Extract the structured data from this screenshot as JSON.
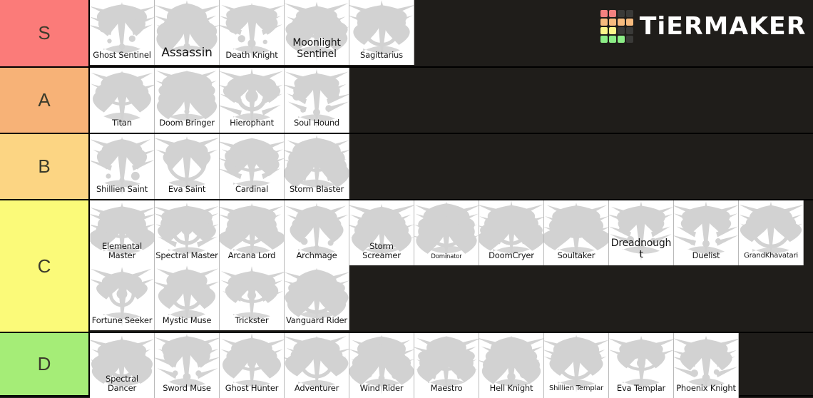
{
  "logo": {
    "wordmark": "TiERMAKER",
    "grid_colors": [
      "#f4817f",
      "#f4817f",
      "#3a3a38",
      "#3a3a38",
      "#f7bb7e",
      "#f7bb7e",
      "#f7bb7e",
      "#f7bb7e",
      "#fbf68a",
      "#fbf68a",
      "#3a3a38",
      "#3a3a38",
      "#8ced87",
      "#8ced87",
      "#8ced87",
      "#3a3a38"
    ]
  },
  "background_color": "#1f1d1a",
  "tiers": [
    {
      "label": "S",
      "color": "#fb7b79",
      "height": 95,
      "items": [
        {
          "name": "Ghost Sentinel",
          "emblem": "ghost-sentinel-emblem",
          "size": "md"
        },
        {
          "name": "Assassin",
          "emblem": "assassin-emblem",
          "size": "xl"
        },
        {
          "name": "Death Knight",
          "emblem": "death-knight-emblem",
          "size": "md"
        },
        {
          "name": "Moonlight Sentinel",
          "emblem": "moonlight-sentinel-emblem",
          "size": "lg"
        },
        {
          "name": "Sagittarius",
          "emblem": "sagittarius-emblem",
          "size": "md"
        }
      ]
    },
    {
      "label": "A",
      "color": "#f7b277",
      "height": 93,
      "items": [
        {
          "name": "Titan",
          "emblem": "titan-emblem",
          "size": "md"
        },
        {
          "name": "Doom Bringer",
          "emblem": "doom-bringer-emblem",
          "size": "md"
        },
        {
          "name": "Hierophant",
          "emblem": "hierophant-emblem",
          "size": "md"
        },
        {
          "name": "Soul Hound",
          "emblem": "soul-hound-emblem",
          "size": "md"
        }
      ]
    },
    {
      "label": "B",
      "color": "#fcd583",
      "height": 93,
      "items": [
        {
          "name": "Shillien Saint",
          "emblem": "shillien-saint-emblem",
          "size": "md"
        },
        {
          "name": "Eva Saint",
          "emblem": "eva-saint-emblem",
          "size": "md"
        },
        {
          "name": "Cardinal",
          "emblem": "cardinal-emblem",
          "size": "md"
        },
        {
          "name": "Storm Blaster",
          "emblem": "storm-blaster-emblem",
          "size": "md"
        }
      ]
    },
    {
      "label": "C",
      "color": "#fbfa79",
      "height": 186,
      "items": [
        {
          "name": "Elemental Master",
          "emblem": "elemental-master-emblem",
          "size": "md"
        },
        {
          "name": "Spectral Master",
          "emblem": "spectral-master-emblem",
          "size": "md"
        },
        {
          "name": "Arcana Lord",
          "emblem": "arcana-lord-emblem",
          "size": "md"
        },
        {
          "name": "Archmage",
          "emblem": "archmage-emblem",
          "size": "md"
        },
        {
          "name": "Storm Screamer",
          "emblem": "storm-screamer-emblem",
          "size": "md"
        },
        {
          "name": "Dominator",
          "emblem": "dominator-emblem",
          "size": "xs"
        },
        {
          "name": "DoomCryer",
          "emblem": "doomcryer-emblem",
          "size": "md"
        },
        {
          "name": "Soultaker",
          "emblem": "soultaker-emblem",
          "size": "md"
        },
        {
          "name": "Dreadnought",
          "emblem": "dreadnought-emblem",
          "size": "lg"
        },
        {
          "name": "Duelist",
          "emblem": "duelist-emblem",
          "size": "md"
        },
        {
          "name": "GrandKhavatari",
          "emblem": "grand-khavatari-emblem",
          "size": "sm"
        },
        {
          "name": "Fortune Seeker",
          "emblem": "fortune-seeker-emblem",
          "size": "md"
        },
        {
          "name": "Mystic Muse",
          "emblem": "mystic-muse-emblem",
          "size": "md"
        },
        {
          "name": "Trickster",
          "emblem": "trickster-emblem",
          "size": "md"
        },
        {
          "name": "Vanguard Rider",
          "emblem": "vanguard-rider-emblem",
          "size": "md"
        }
      ]
    },
    {
      "label": "D",
      "color": "#a5ed77",
      "height": 89,
      "items": [
        {
          "name": "Spectral Dancer",
          "emblem": "spectral-dancer-emblem",
          "size": "md"
        },
        {
          "name": "Sword Muse",
          "emblem": "sword-muse-emblem",
          "size": "md"
        },
        {
          "name": "Ghost Hunter",
          "emblem": "ghost-hunter-emblem",
          "size": "md"
        },
        {
          "name": "Adventurer",
          "emblem": "adventurer-emblem",
          "size": "md"
        },
        {
          "name": "Wind Rider",
          "emblem": "wind-rider-emblem",
          "size": "md"
        },
        {
          "name": "Maestro",
          "emblem": "maestro-emblem",
          "size": "md"
        },
        {
          "name": "Hell Knight",
          "emblem": "hell-knight-emblem",
          "size": "md"
        },
        {
          "name": "Shillien Templar",
          "emblem": "shillien-templar-emblem",
          "size": "sm"
        },
        {
          "name": "Eva Templar",
          "emblem": "eva-templar-emblem",
          "size": "md"
        },
        {
          "name": "Phoenix Knight",
          "emblem": "phoenix-knight-emblem",
          "size": "md"
        }
      ]
    }
  ]
}
